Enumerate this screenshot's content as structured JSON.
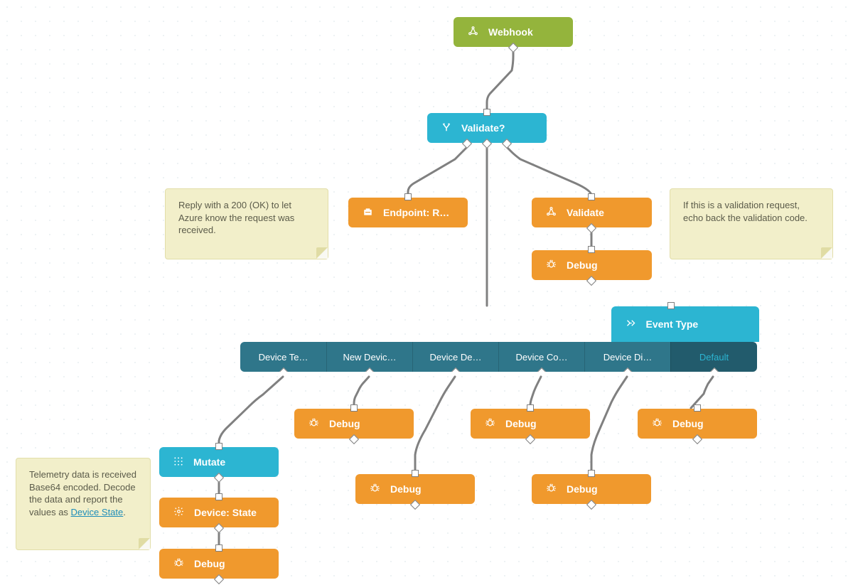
{
  "nodes": {
    "webhook": {
      "label": "Webhook"
    },
    "validate_q": {
      "label": "Validate?"
    },
    "endpoint_r": {
      "label": "Endpoint: R…"
    },
    "validate": {
      "label": "Validate"
    },
    "debug_val": {
      "label": "Debug"
    },
    "event_type": {
      "label": "Event Type"
    },
    "mutate": {
      "label": "Mutate"
    },
    "device_state": {
      "label": "Device: State"
    },
    "debug_state": {
      "label": "Debug"
    },
    "debug_new": {
      "label": "Debug"
    },
    "debug_del": {
      "label": "Debug"
    },
    "debug_conn": {
      "label": "Debug"
    },
    "debug_disc": {
      "label": "Debug"
    },
    "debug_default": {
      "label": "Debug"
    }
  },
  "switch_cases": [
    {
      "label": "Device Te…"
    },
    {
      "label": "New Devic…"
    },
    {
      "label": "Device De…"
    },
    {
      "label": "Device Co…"
    },
    {
      "label": "Device Di…"
    },
    {
      "label": "Default"
    }
  ],
  "notes": {
    "azure_ok": {
      "text": "Reply with a 200 (OK) to let Azure know the request was received."
    },
    "validation_echo": {
      "text": "If this is a validation request, echo back the validation code."
    },
    "telemetry": {
      "prefix": "Telemetry data is received Base64 encoded. Decode the data and report the values as ",
      "link_text": "Device State",
      "suffix": "."
    }
  }
}
